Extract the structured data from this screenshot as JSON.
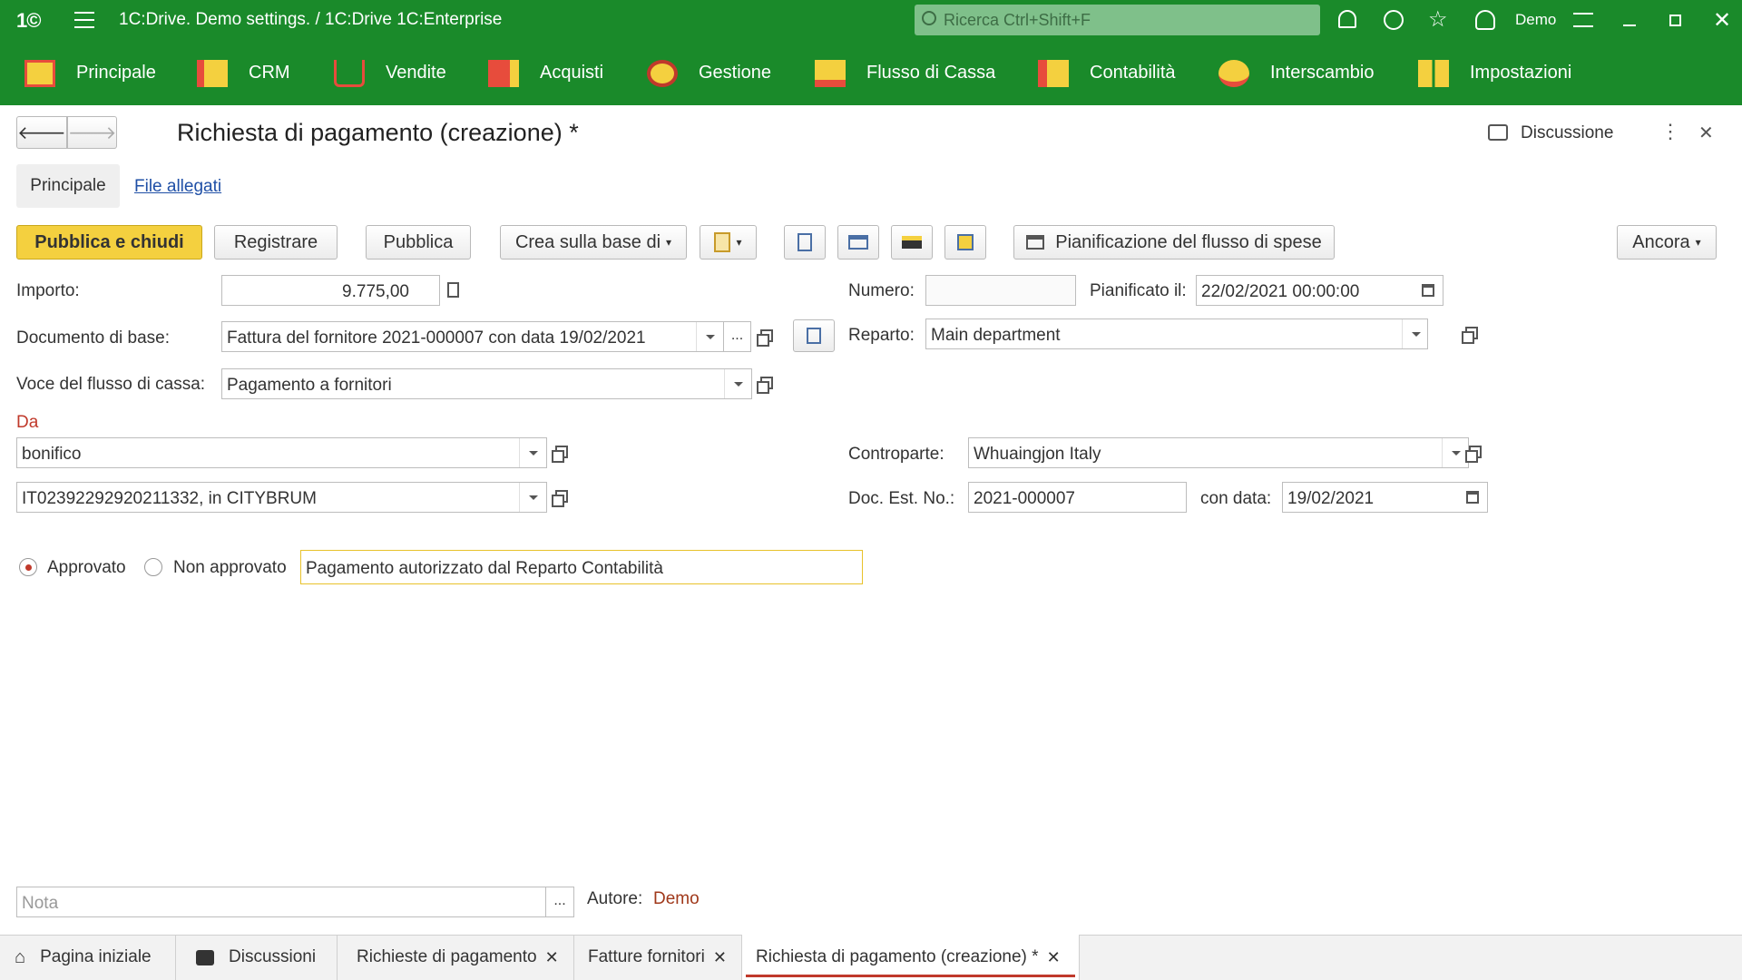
{
  "app": {
    "title": "1C:Drive. Demo settings. / 1C:Drive 1C:Enterprise",
    "search_placeholder": "Ricerca Ctrl+Shift+F",
    "user": "Demo"
  },
  "sections": [
    "Principale",
    "CRM",
    "Vendite",
    "Acquisti",
    "Gestione",
    "Flusso di Cassa",
    "Contabilità",
    "Interscambio",
    "Impostazioni"
  ],
  "form": {
    "title": "Richiesta di pagamento (creazione) *",
    "discussion": "Discussione",
    "tabs": [
      "Principale",
      "File allegati"
    ]
  },
  "toolbar": {
    "post_close": "Pubblica e chiudi",
    "register": "Registrare",
    "post": "Pubblica",
    "create_based": "Crea sulla base di",
    "cashflow_plan": "Pianificazione del flusso di spese",
    "more": "Ancora"
  },
  "fields": {
    "amount_label": "Importo:",
    "amount": "9.775,00",
    "number_label": "Numero:",
    "number": "",
    "planned_label": "Pianificato il:",
    "planned": "22/02/2021 00:00:00",
    "base_doc_label": "Documento di base:",
    "base_doc": "Fattura del fornitore 2021-000007 con data 19/02/2021",
    "department_label": "Reparto:",
    "department": "Main department",
    "cashflow_item_label": "Voce del flusso di cassa:",
    "cashflow_item": "Pagamento a fornitori",
    "from_label": "Da",
    "payment_method": "bonifico",
    "bank_account": "IT02392292920211332, in CITYBRUM",
    "counterparty_label": "Controparte:",
    "counterparty": "Whuaingjon Italy",
    "ext_doc_label": "Doc. Est. No.:",
    "ext_doc": "2021-000007",
    "date_label": "con data:",
    "date": "19/02/2021",
    "approved": "Approvato",
    "not_approved": "Non approvato",
    "approval_comment": "Pagamento autorizzato dal Reparto Contabilità",
    "note_placeholder": "Nota",
    "author_label": "Autore:",
    "author": "Demo"
  },
  "bottom_tabs": [
    "Pagina iniziale",
    "Discussioni",
    "Richieste di pagamento",
    "Fatture fornitori",
    "Richiesta di pagamento (creazione) *"
  ],
  "colors": {
    "brand": "#1a8a2a",
    "primary_button": "#f4d03f",
    "required_label": "#c0392b",
    "author": "#a0391b"
  }
}
